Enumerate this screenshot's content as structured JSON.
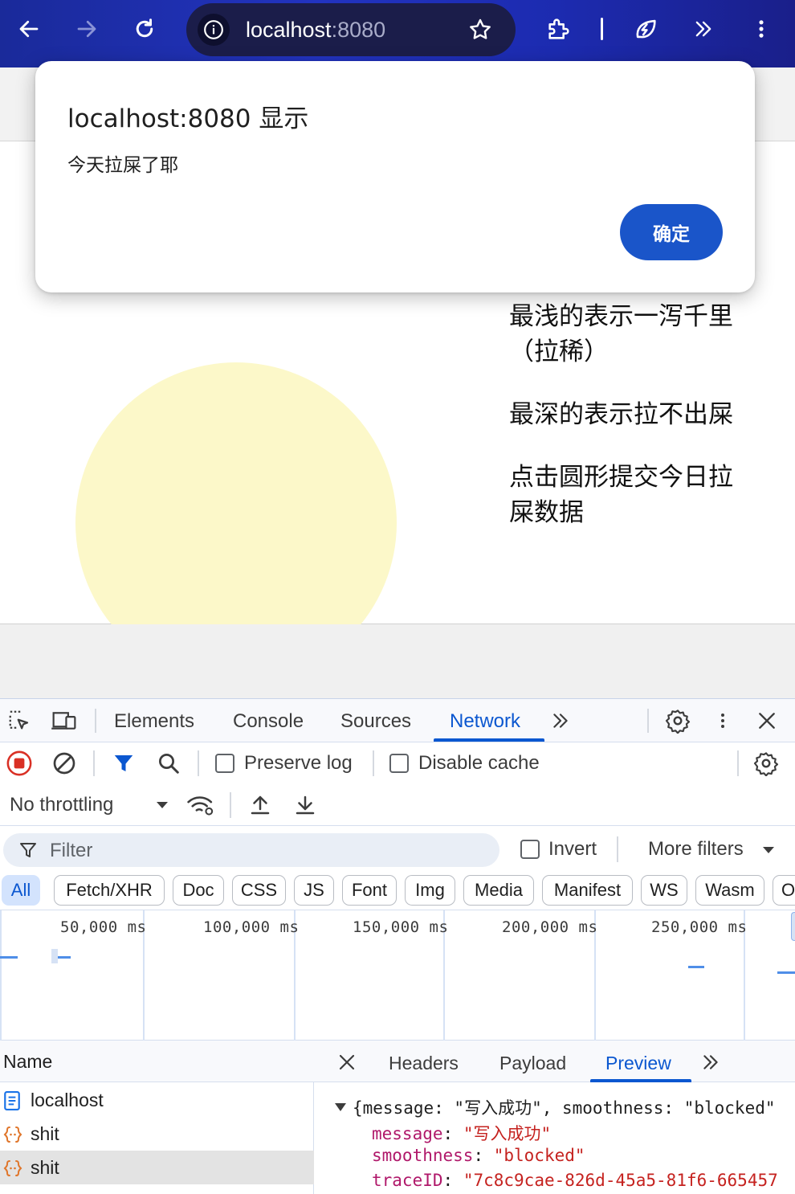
{
  "browser": {
    "url_host": "localhost",
    "url_port": ":8080",
    "more_label": "»"
  },
  "page": {
    "hint_lines": [
      "最浅的表示一泻千里（拉稀）",
      "最深的表示拉不出屎",
      "点击圆形提交今日拉屎数据"
    ],
    "circle_color": "#fcf8c9"
  },
  "dialog": {
    "title": "localhost:8080 显示",
    "message": "今天拉屎了耶",
    "ok_label": "确定"
  },
  "devtools": {
    "tabs": [
      "Elements",
      "Console",
      "Sources",
      "Network"
    ],
    "active_tab": "Network",
    "more_tabs_label": "»",
    "preserve_log_label": "Preserve log",
    "disable_cache_label": "Disable cache",
    "throttling_value": "No throttling",
    "filter_placeholder": "Filter",
    "invert_label": "Invert",
    "more_filters_label": "More filters",
    "type_chips": [
      "All",
      "Fetch/XHR",
      "Doc",
      "CSS",
      "JS",
      "Font",
      "Img",
      "Media",
      "Manifest",
      "WS",
      "Wasm",
      "O"
    ],
    "active_chip": "All",
    "timeline_labels": [
      "50,000 ms",
      "100,000 ms",
      "150,000 ms",
      "200,000 ms",
      "250,000 ms"
    ],
    "name_header": "Name",
    "requests": [
      {
        "name": "localhost",
        "type": "doc"
      },
      {
        "name": "shit",
        "type": "fetch"
      },
      {
        "name": "shit",
        "type": "fetch",
        "selected": true
      }
    ],
    "detail_tabs": [
      "Headers",
      "Payload",
      "Preview"
    ],
    "active_detail_tab": "Preview",
    "preview": {
      "summary": "{message: \"写入成功\", smoothness: \"blocked\"",
      "fields": [
        {
          "key": "message",
          "value": "\"写入成功\""
        },
        {
          "key": "smoothness",
          "value": "\"blocked\""
        },
        {
          "key": "traceID",
          "value": "\"7c8c9cae-826d-45a5-81f6-665457"
        }
      ]
    },
    "accent_color": "#0b57d0"
  }
}
